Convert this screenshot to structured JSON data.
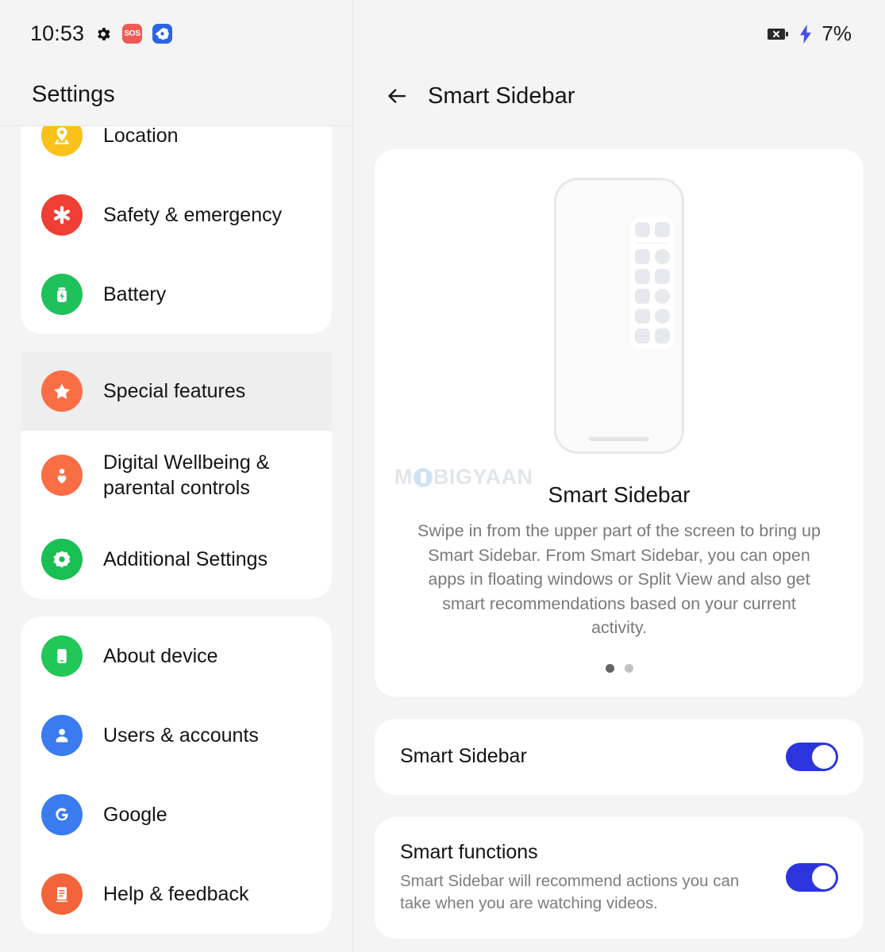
{
  "status_bar": {
    "time": "10:53",
    "icons_left": [
      "gear-icon",
      "sos-badge-icon",
      "app-badge-icon"
    ],
    "sos_label": "SOS",
    "icons_right": [
      "battery-x-icon",
      "charging-bolt-icon"
    ],
    "battery_percent": "7%"
  },
  "sidebar": {
    "title": "Settings",
    "groups": [
      {
        "items": [
          {
            "label": "Location",
            "icon": "location-pin-icon",
            "color": "#f9c21b",
            "selected": false
          },
          {
            "label": "Safety & emergency",
            "icon": "emergency-asterisk-icon",
            "color": "#ef3e33",
            "selected": false
          },
          {
            "label": "Battery",
            "icon": "battery-icon",
            "color": "#1ec15a",
            "selected": false
          }
        ]
      },
      {
        "items": [
          {
            "label": "Special features",
            "icon": "star-icon",
            "color": "#f96e44",
            "selected": true
          },
          {
            "label": "Digital Wellbeing & parental controls",
            "icon": "person-heart-icon",
            "color": "#f96e44",
            "selected": false
          },
          {
            "label": "Additional Settings",
            "icon": "gear-flower-icon",
            "color": "#18bf52",
            "selected": false
          }
        ]
      },
      {
        "items": [
          {
            "label": "About device",
            "icon": "phone-icon",
            "color": "#21c757",
            "selected": false
          },
          {
            "label": "Users & accounts",
            "icon": "person-icon",
            "color": "#3a7bf0",
            "selected": false
          },
          {
            "label": "Google",
            "icon": "google-g-icon",
            "color": "#3a7bf0",
            "selected": false
          },
          {
            "label": "Help & feedback",
            "icon": "help-document-icon",
            "color": "#f4643a",
            "selected": false
          }
        ]
      }
    ]
  },
  "detail": {
    "back_icon": "back-arrow-icon",
    "title": "Smart Sidebar",
    "hero": {
      "illustration": "phone-with-sidebar-illustration",
      "watermark": "MOBIGYAAN",
      "heading": "Smart Sidebar",
      "description": "Swipe in from the upper part of the screen to bring up Smart Sidebar. From Smart Sidebar, you can open apps in floating windows or Split View and also get smart recommendations based on your current activity.",
      "page_dots": {
        "count": 2,
        "active_index": 0
      }
    },
    "settings": [
      {
        "title": "Smart Sidebar",
        "subtitle": "",
        "toggle_on": true
      },
      {
        "title": "Smart functions",
        "subtitle": "Smart Sidebar will recommend actions you can take when you are watching videos.",
        "toggle_on": true
      }
    ]
  },
  "colors": {
    "accent_toggle": "#2c35dd",
    "page_background": "#f4f4f4",
    "card_background": "#ffffff",
    "selected_row": "#eeeeee"
  }
}
